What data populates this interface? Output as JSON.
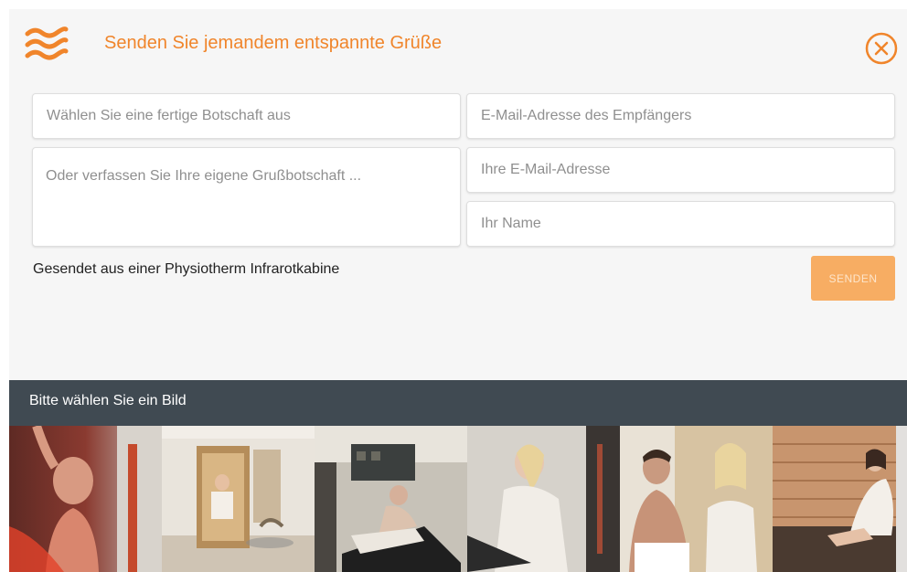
{
  "header": {
    "title": "Senden Sie jemandem entspannte Grüße",
    "accent_color": "#f0852b",
    "logo_icon": "waves-logo-icon",
    "close_icon": "close-circle-icon"
  },
  "form": {
    "message_select_placeholder": "Wählen Sie eine fertige Botschaft aus",
    "own_message_placeholder": "Oder verfassen Sie Ihre eigene Grußbotschaft ...",
    "recipient_email_placeholder": "E-Mail-Adresse des Empfängers",
    "own_email_placeholder": "Ihre E-Mail-Adresse",
    "name_placeholder": "Ihr Name",
    "footer_note": "Gesendet aus einer Physiotherm Infrarotkabine",
    "send_label": "SENDEN",
    "send_color": "#f7ad63"
  },
  "gallery": {
    "title": "Bitte wählen Sie ein Bild",
    "bar_color": "#404a52",
    "images": [
      {
        "name": "woman-red-light-photo"
      },
      {
        "name": "infrared-cabin-photo"
      },
      {
        "name": "man-recliner-lounge-photo"
      },
      {
        "name": "woman-towel-lounger-photo"
      },
      {
        "name": "couple-sauna-photo"
      },
      {
        "name": "woman-wooden-bench-photo"
      }
    ]
  }
}
